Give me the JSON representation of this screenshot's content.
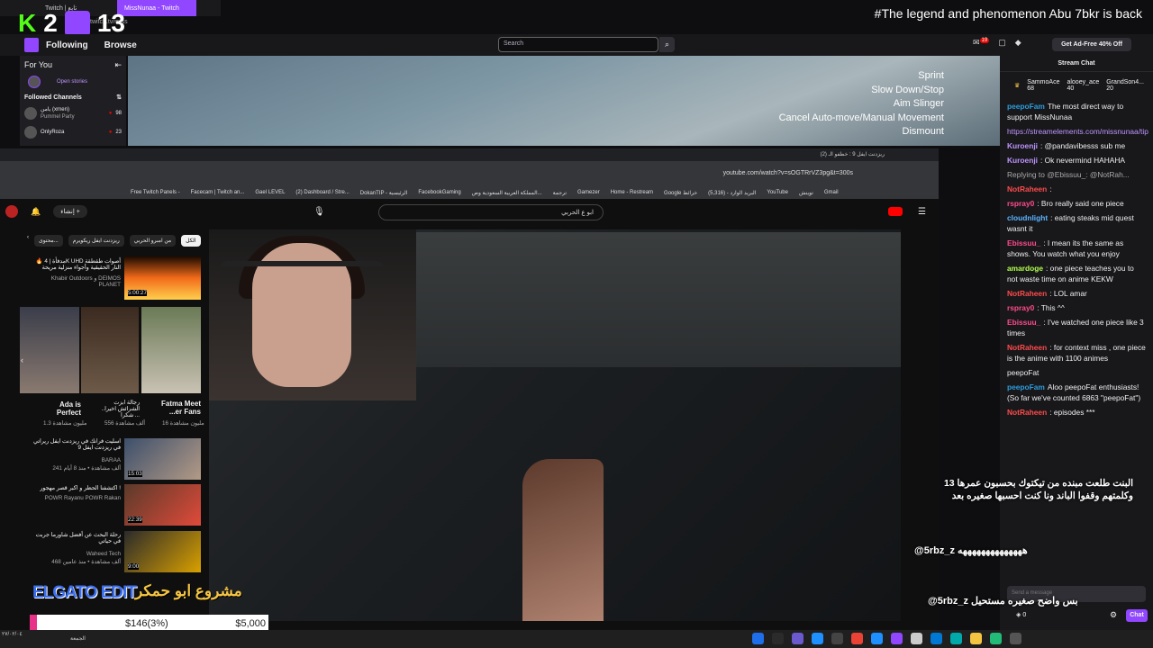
{
  "browser": {
    "tabs": [
      "Twitch | تابع",
      "MissNunaa - Twitch"
    ],
    "url": "twitch.tv/miss"
  },
  "overlay": {
    "kick_score_1": "2",
    "kick_score_2": "13",
    "headline": "#The legend and phenomenon Abu 7bkr is back"
  },
  "twitch_nav": {
    "following": "Following",
    "browse": "Browse",
    "search_placeholder": "Search",
    "notifications": "19",
    "ad_free": "Get Ad-Free 40% Off"
  },
  "sidebar": {
    "title": "For You",
    "open_stories": "Open stories",
    "followed_title": "Followed Channels",
    "channels": [
      {
        "name": "يامن (xrnen)",
        "game": "Pummel Party",
        "viewers": "98"
      },
      {
        "name": "OnlyRoza",
        "game": "",
        "viewers": "23"
      }
    ]
  },
  "game_hud": {
    "controls": [
      "Sprint",
      "Slow Down/Stop",
      "Aim Slinger",
      "Cancel Auto-move/Manual Movement",
      "Dismount"
    ]
  },
  "chat": {
    "header": "Stream Chat",
    "hype": [
      {
        "name": "SammoAce",
        "count": "68"
      },
      {
        "name": "alooey_ace",
        "count": "40"
      },
      {
        "name": "GrandSon4...",
        "count": "20"
      }
    ],
    "messages": [
      {
        "user": "peepoFam",
        "text": "The most direct way to support MissNunaa",
        "color": "#2d9cdb"
      },
      {
        "user": "",
        "text": "https://streamelements.com/missnunaa/tip",
        "color": "#bf94ff"
      },
      {
        "user": "Kuroenji",
        "text": ": @pandavibesss sub me",
        "color": "#bf94ff"
      },
      {
        "user": "Kuroenji",
        "text": ": Ok nevermind HAHAHA",
        "color": "#bf94ff"
      },
      {
        "user": "",
        "text": "Replying to @Ebissuu_: @NotRah...",
        "color": "#aaa"
      },
      {
        "user": "NotRaheen",
        "text": ":",
        "color": "#ff4b4b"
      },
      {
        "user": "rspray0",
        "text": ": Bro really said one piece",
        "color": "#ff4b8b"
      },
      {
        "user": "cloudnlight",
        "text": ": eating steaks mid quest wasnt it",
        "color": "#5ab4ff"
      },
      {
        "user": "Ebissuu_",
        "text": ": I mean its the same as shows. You watch what you enjoy",
        "color": "#ff4b8b"
      },
      {
        "user": "amardoge",
        "text": ": one piece teaches you to not waste time on anime KEKW",
        "color": "#b0ff4b"
      },
      {
        "user": "NotRaheen",
        "text": ": LOL amar",
        "color": "#ff4b4b"
      },
      {
        "user": "rspray0",
        "text": ": This ^^",
        "color": "#ff4b8b"
      },
      {
        "user": "Ebissuu_",
        "text": ": I've watched one piece like 3 times",
        "color": "#ff4b8b"
      },
      {
        "user": "NotRaheen",
        "text": ": for context miss , one piece is the anime with 1100 animes",
        "color": "#ff4b4b"
      },
      {
        "user": "",
        "text": "peepoFat",
        "color": "#efeff1"
      },
      {
        "user": "peepoFam",
        "text": "Aloo peepoFat enthusiasts! (So far we've counted 6863 \"peepoFat\")",
        "color": "#2d9cdb"
      },
      {
        "user": "NotRaheen",
        "text": ": episodes ***",
        "color": "#ff4b4b"
      }
    ],
    "input_placeholder": "Send a message",
    "points": "0",
    "chat_button": "Chat"
  },
  "youtube": {
    "tab_title": "(2) ريزدنت ايفل 9 : خطفو الـ",
    "url": "youtube.com/watch?v=sOGTRrVZ3pg&t=300s",
    "bookmarks": [
      "Free Twitch Panels -",
      "Facecam | Twitch an...",
      "Gael LEVEL",
      "(2) Dashboard / Stre...",
      "DokanTIP - الرئيسية",
      "FacebookGaming",
      "المملكة العربية السعودية وص...",
      "ترجمة",
      "Gamezer",
      "Home - Restream",
      "Google خرائط",
      "(5,316) - البريد الوارد",
      "YouTube",
      "توينش",
      "Gmail"
    ],
    "search_query": "ابو ع الحربي",
    "create": "إنشاء",
    "chips": [
      "محتوى...",
      "ريزدنت ايفل ريكويرم",
      "من امبرو الحربي",
      "الكل"
    ],
    "recommendations": [
      {
        "title": "🔥 مدفأة | 4K UHD أصوات طقطقة النار الحقيقية وأجواء منزلية مريحة",
        "channel": "Khabir Outdoors و DEIMOS PLANET",
        "meta": "",
        "duration": "5:00:27"
      },
      {
        "title": "Ada is Perfect",
        "channel": "",
        "meta": "1.3 مليون مشاهدة",
        "duration": ""
      },
      {
        "title": "رجالة ابزت الشرائش اخيرا.. شكرا ...",
        "channel": "",
        "meta": "556 ألف مشاهدة",
        "duration": ""
      },
      {
        "title": "Fatma Meet ...er Fans",
        "channel": "",
        "meta": "16 مليون مشاهدة",
        "duration": ""
      },
      {
        "title": "اسليت فرانك في ريزدنت ايفل ريراتي في ريزدنت ايفل 9",
        "channel": "BARAA",
        "meta": "241 ألف مشاهدة • منذ 8 أيام",
        "duration": "15:03"
      },
      {
        "title": "اكتشفنا الحظر و اكبر قصر مهجور !",
        "channel": "POWR Rayanu POWR Rakan",
        "meta": "",
        "duration": "22:39"
      },
      {
        "title": "رحلة البحث عن أفضل شاورما جربت في حياتي",
        "channel": "Waheed Tech",
        "meta": "468 ألف مشاهدة • منذ عامين",
        "duration": "9:00"
      }
    ]
  },
  "stream_overlay": {
    "tiktok_text": "البنت طلعت مبنده من تيكتوك بحسبون عمرها 13 وكلمتهم وقفوا الباند ونا كنت احسبها صغيره بعد",
    "handle1": "@5rbz_z",
    "handle1_suffix": "ههههههههههههههه",
    "handle2": "@5rbz_z",
    "handle2_text": "بس واضح صغيره مستحيل",
    "project_label": "مشروع ابو حمكر",
    "elgato": "ELGATO EDIT",
    "goal_current": "$146(3%)",
    "goal_target": "$5,000",
    "goal_progress": 0.03
  },
  "taskbar": {
    "time": "الجمعة",
    "date": "٢٧/٠٢/٠٤"
  },
  "colors": {
    "twitch_purple": "#9146ff",
    "kick_green": "#53fc18"
  }
}
